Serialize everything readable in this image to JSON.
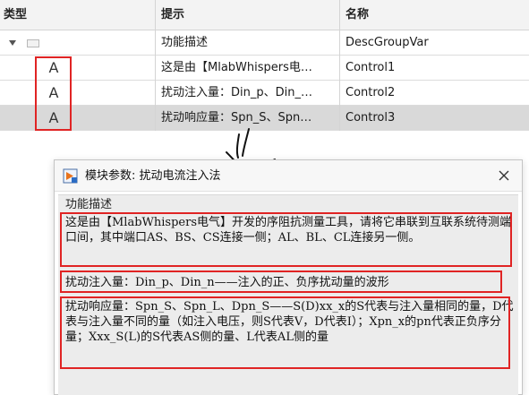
{
  "table": {
    "headers": {
      "type": "类型",
      "hint": "提示",
      "name": "名称"
    },
    "rows": [
      {
        "hint": "功能描述",
        "name": "DescGroupVar"
      },
      {
        "type_glyph": "A",
        "hint": "这是由【MlabWhispers电…",
        "name": "Control1"
      },
      {
        "type_glyph": "A",
        "hint": "扰动注入量：Din_p、Din_…",
        "name": "Control2"
      },
      {
        "type_glyph": "A",
        "hint": "扰动响应量：Spn_S、Spn…",
        "name": "Control3"
      }
    ]
  },
  "dialog": {
    "title": "模块参数: 扰动电流注入法",
    "section_label": "功能描述",
    "desc1": "这是由【MlabWhispers电气】开发的序阻抗测量工具，请将它串联到互联系统待测端口间，其中端口AS、BS、CS连接一侧；AL、BL、CL连接另一侧。",
    "desc2": "扰动注入量：Din_p、Din_n——注入的正、负序扰动量的波形",
    "desc3": "扰动响应量：Spn_S、Spn_L、Dpn_S——S(D)xx_x的S代表与注入量相同的量，D代表与注入量不同的量（如注入电压，则S代表V，D代表I）；Xpn_x的pn代表正负序分量；Xxx_S(L)的S代表AS侧的量、L代表AL侧的量"
  },
  "colors": {
    "highlight": "#e02424",
    "selected_row": "#d9d9d9"
  },
  "icons": [
    "expand-triangle-icon",
    "group-folder-icon",
    "text-parameter-icon",
    "simulink-block-icon",
    "close-icon",
    "hand-drawn-arrow"
  ]
}
